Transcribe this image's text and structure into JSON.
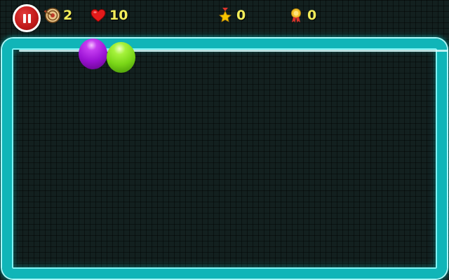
{
  "hud": {
    "pause_icon": "pause-icon",
    "targets": {
      "icon": "target-icon",
      "value": "2"
    },
    "lives": {
      "icon": "heart-icon",
      "value": "10"
    },
    "stars": {
      "icon": "star-medal-icon",
      "value": "0"
    },
    "medals": {
      "icon": "gold-medal-icon",
      "value": "0"
    }
  },
  "playfield": {
    "border_color": "#10b5b8",
    "background_color": "#13201f"
  },
  "balloons": [
    {
      "color_name": "purple",
      "color": "#9b12d4"
    },
    {
      "color_name": "green",
      "color": "#79d617"
    }
  ],
  "accent_colors": {
    "pause_button": "#c01818",
    "hud_text": "#f2ee5a"
  }
}
